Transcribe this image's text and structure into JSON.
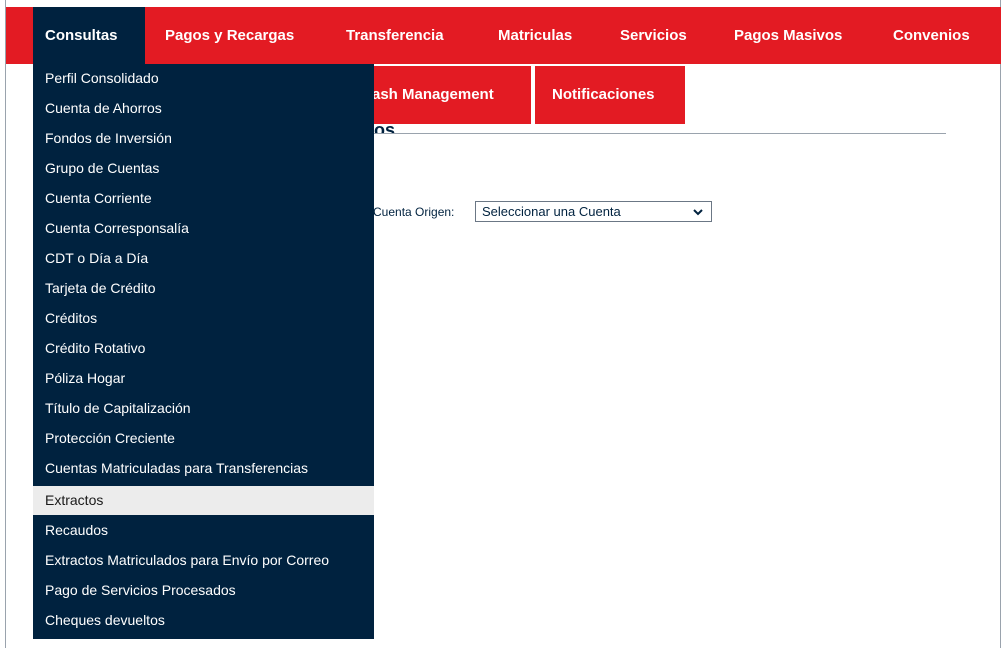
{
  "topnav": {
    "items": [
      {
        "label": "Consultas"
      },
      {
        "label": "Pagos y Recargas"
      },
      {
        "label": "Transferencia"
      },
      {
        "label": "Matriculas"
      },
      {
        "label": "Servicios"
      },
      {
        "label": "Pagos Masivos"
      },
      {
        "label": "Convenios"
      }
    ]
  },
  "subtabs": {
    "items": [
      {
        "label": "ash Management"
      },
      {
        "label": "Notificaciones"
      }
    ]
  },
  "page": {
    "title_fragment": "os"
  },
  "form": {
    "account_label": "Cuenta Origen:",
    "account_select_value": "Seleccionar una Cuenta"
  },
  "dropdown": {
    "items": [
      {
        "label": "Perfil Consolidado"
      },
      {
        "label": "Cuenta de Ahorros"
      },
      {
        "label": "Fondos de Inversión"
      },
      {
        "label": "Grupo de Cuentas"
      },
      {
        "label": "Cuenta Corriente"
      },
      {
        "label": "Cuenta Corresponsalía"
      },
      {
        "label": "CDT o Día a Día"
      },
      {
        "label": "Tarjeta de Crédito"
      },
      {
        "label": "Créditos"
      },
      {
        "label": "Crédito Rotativo"
      },
      {
        "label": "Póliza Hogar"
      },
      {
        "label": "Título de Capitalización"
      },
      {
        "label": "Protección Creciente"
      },
      {
        "label": "Cuentas Matriculadas para Transferencias"
      },
      {
        "label": "Extractos"
      },
      {
        "label": "Recaudos"
      },
      {
        "label": "Extractos Matriculados para Envío por Correo"
      },
      {
        "label": "Pago de Servicios Procesados"
      },
      {
        "label": "Cheques devueltos"
      }
    ]
  },
  "colors": {
    "brand_red": "#e31b23",
    "navy": "#00223f",
    "hover_gray": "#ececec"
  }
}
